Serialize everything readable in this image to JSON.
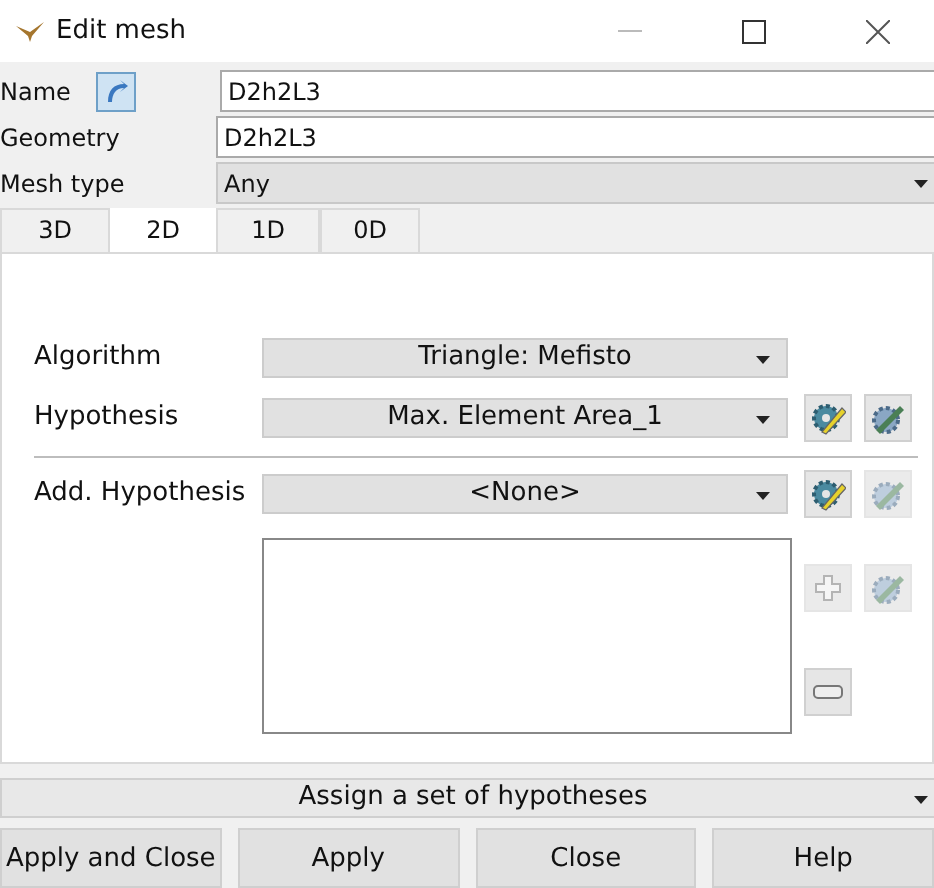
{
  "window": {
    "title": "Edit mesh"
  },
  "fields": [
    {
      "kind": "text",
      "label": "Name",
      "value": "D2h2L3",
      "select_button": true
    },
    {
      "kind": "text",
      "label": "Geometry",
      "value": "D2h2L3",
      "select_button": false
    },
    {
      "kind": "combo",
      "label": "Mesh type",
      "value": "Any",
      "select_button": false
    }
  ],
  "tabs": [
    {
      "label": "3D",
      "selected": false
    },
    {
      "label": "2D",
      "selected": true
    },
    {
      "label": "1D",
      "selected": false
    },
    {
      "label": "0D",
      "selected": false
    }
  ],
  "panel": {
    "algorithm": {
      "label": "Algorithm",
      "value": "Triangle: Mefisto"
    },
    "hypothesis": {
      "label": "Hypothesis",
      "value": "Max. Element Area_1",
      "buttons": [
        {
          "kind": "create",
          "disabled": false
        },
        {
          "kind": "edit",
          "disabled": false
        }
      ]
    },
    "additional": {
      "label": "Add. Hypothesis",
      "value": "<None>",
      "buttons": [
        {
          "kind": "create",
          "disabled": false
        },
        {
          "kind": "edit",
          "disabled": true
        }
      ]
    },
    "list_buttons": [
      {
        "kind": "add",
        "disabled": true
      },
      {
        "kind": "edit",
        "disabled": true
      },
      {
        "kind": "remove",
        "disabled": false
      }
    ]
  },
  "hypothesis_set": "Assign a set of hypotheses",
  "buttons": [
    "Apply and Close",
    "Apply",
    "Close",
    "Help"
  ]
}
